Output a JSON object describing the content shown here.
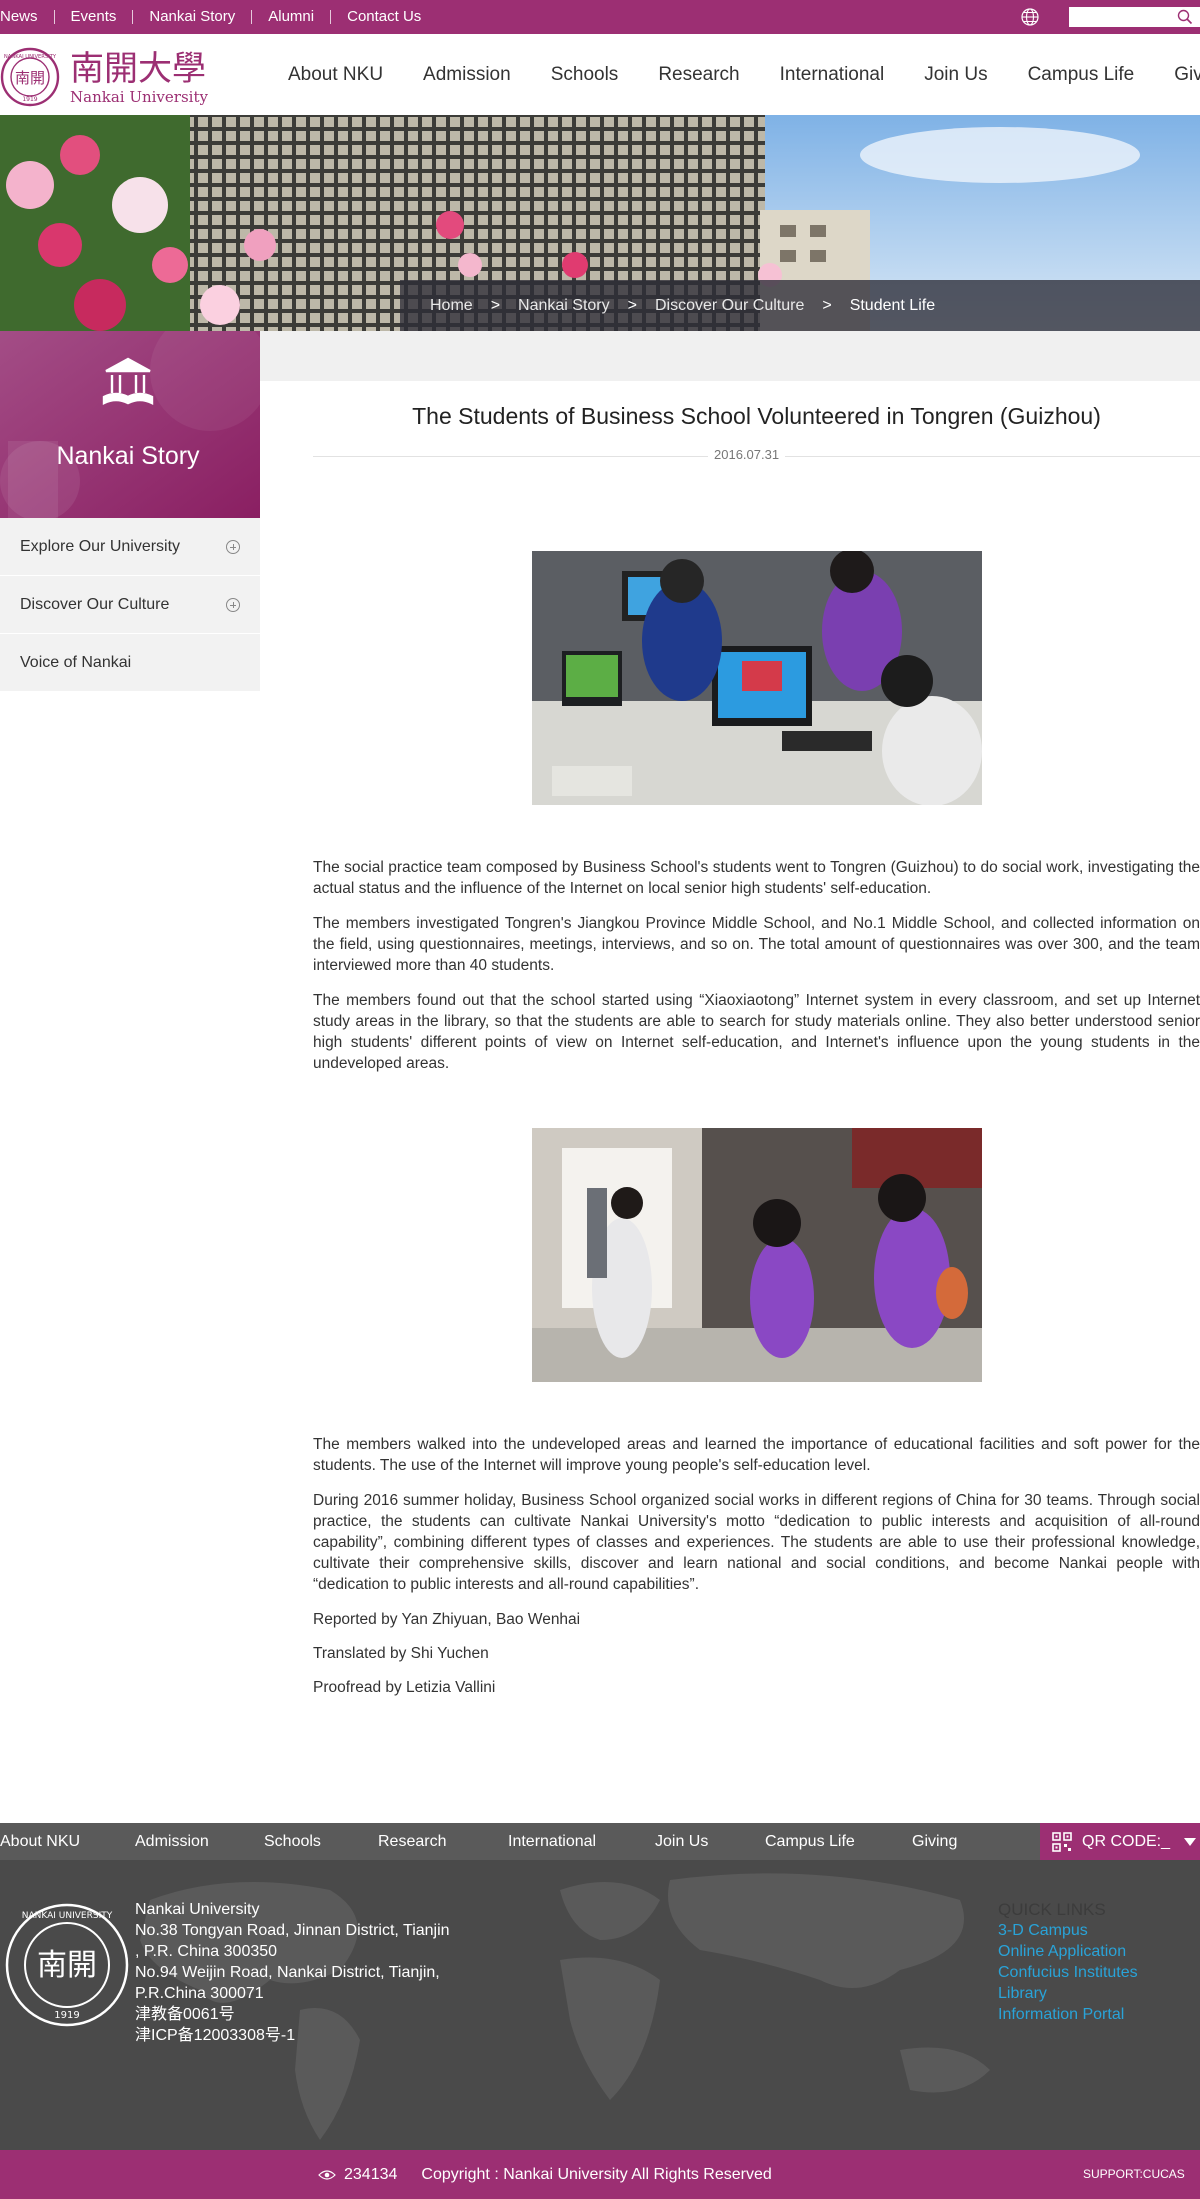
{
  "topbar": {
    "links": [
      "News",
      "Events",
      "Nankai Story",
      "Alumni",
      "Contact Us"
    ],
    "search_placeholder": "",
    "bar_color": "#9c2f73"
  },
  "header": {
    "logo": {
      "chinese": "南開大學",
      "english": "Nankai University",
      "seal_year": "1919",
      "seal_text": "NANKAI UNIVERSITY"
    },
    "nav": [
      "About NKU",
      "Admission",
      "Schools",
      "Research",
      "International",
      "Join Us",
      "Campus Life",
      "Giving"
    ]
  },
  "breadcrumb": {
    "items": [
      "Home",
      "Nankai Story",
      "Discover Our Culture"
    ],
    "current": "Student Life",
    "separator": ">"
  },
  "sidebar": {
    "title": "Nankai Story",
    "items": [
      {
        "label": "Explore Our University",
        "expandable": true
      },
      {
        "label": "Discover Our Culture",
        "expandable": true
      },
      {
        "label": "Voice of Nankai",
        "expandable": false
      }
    ]
  },
  "article": {
    "title": "The Students of Business School Volunteered in Tongren (Guizhou)",
    "date": "2016.07.31",
    "paragraphs_1": [
      "The social practice team composed by Business School's students went to Tongren (Guizhou) to do social work, investigating the actual status and the influence of the Internet on local senior high students' self-education.",
      "The members investigated Tongren's Jiangkou Province Middle School, and No.1 Middle School, and collected information on the field, using questionnaires, meetings, interviews, and so on. The total amount of questionnaires was over 300, and the team interviewed more than 40 students.",
      "The members found out that the school started using “Xiaoxiaotong” Internet system in every classroom, and set up Internet study areas in the library, so that the students are able to search for study materials online. They also better understood senior high students' different points of view on Internet self-education, and Internet's influence upon the young students in the undeveloped areas."
    ],
    "paragraphs_2": [
      "The members walked into the undeveloped areas and learned the importance of educational facilities and soft power for the students. The use of the Internet will improve young people's self-education level.",
      "During 2016 summer holiday, Business School organized social works in different regions of China for 30 teams. Through social practice, the students can cultivate Nankai University's motto “dedication to public interests and acquisition of all-round capability”, combining different types of classes and experiences. The students are able to use their professional knowledge, cultivate their comprehensive skills, discover and learn national and social conditions, and become Nankai people with “dedication to public interests and all-round capabilities”."
    ],
    "credits": [
      "Reported by Yan Zhiyuan, Bao Wenhai",
      "Translated by Shi Yuchen",
      "Proofread by Letizia Vallini"
    ]
  },
  "footer": {
    "nav": [
      "About NKU",
      "Admission",
      "Schools",
      "Research",
      "International",
      "Join Us",
      "Campus Life",
      "Giving"
    ],
    "qr_label": "QR CODE:_",
    "address_lines": [
      "Nankai University",
      "No.38 Tongyan Road, Jinnan District, Tianjin",
      ", P.R. China 300350",
      "No.94 Weijin Road,  Nankai District, Tianjin,",
      "P.R.China  300071",
      "津教备0061号",
      "津ICP备12003308号-1"
    ],
    "quick_links_title": "QUICK LINKS",
    "quick_links": [
      "3-D Campus",
      "Online Application",
      "Confucius Institutes",
      "Library",
      "Information Portal"
    ],
    "visits": "234134",
    "copyright": "Copyright : Nankai University All Rights Reserved",
    "support": "SUPPORT:CUCAS",
    "link_color": "#29a3d8"
  }
}
